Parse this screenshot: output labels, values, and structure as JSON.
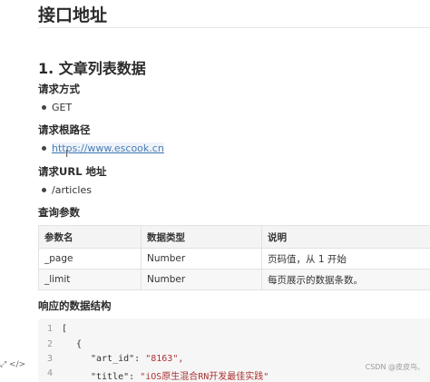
{
  "page_title": "接口地址",
  "section_title": "1. 文章列表数据",
  "method": {
    "heading": "请求方式",
    "value": "GET"
  },
  "root_path": {
    "heading": "请求根路径",
    "value": "https://www.escook.cn"
  },
  "url": {
    "heading": "请求URL 地址",
    "value": "/articles"
  },
  "params": {
    "heading": "查询参数",
    "headers": [
      "参数名",
      "数据类型",
      "说明"
    ],
    "rows": [
      [
        "_page",
        "Number",
        "页码值，从 1 开始"
      ],
      [
        "_limit",
        "Number",
        "每页展示的数据条数。"
      ]
    ]
  },
  "response": {
    "heading": "响应的数据结构",
    "lines": [
      {
        "no": "1",
        "text": "["
      },
      {
        "no": "2",
        "text": "{"
      },
      {
        "no": "3",
        "key": "\"art_id\": ",
        "value": "\"8163\","
      },
      {
        "no": "4",
        "key": "\"title\": ",
        "value": "\"iOS原生混合RN开发最佳实践\""
      }
    ]
  },
  "footer": {
    "left_icons": "⤢  </>",
    "watermark": "CSDN @皮皮鸟、"
  }
}
